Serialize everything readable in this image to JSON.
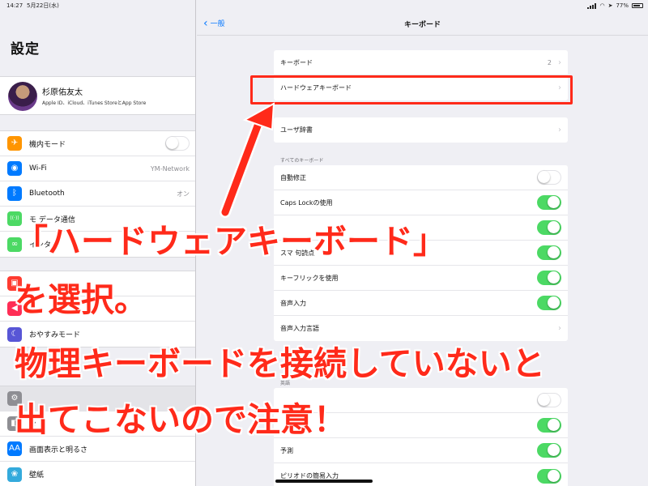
{
  "status_bar": {
    "time": "14:27",
    "date": "5月22日(水)",
    "battery": "77%"
  },
  "sidebar": {
    "title": "設定",
    "profile": {
      "name": "杉原佑友太",
      "subtitle": "Apple ID、iCloud、iTunes StoreとApp Store"
    },
    "group1": [
      {
        "label": "機内モード",
        "icon": "airplane-icon",
        "color": "#ff9500",
        "glyph": "✈",
        "toggle": "off"
      },
      {
        "label": "Wi-Fi",
        "icon": "wifi-icon",
        "color": "#007aff",
        "glyph": "◉",
        "value": "YM-Network"
      },
      {
        "label": "Bluetooth",
        "icon": "bluetooth-icon",
        "color": "#007aff",
        "glyph": "ᛒ",
        "value": "オン"
      },
      {
        "label": "モ  データ通信",
        "icon": "cellular-icon",
        "color": "#4cd964",
        "glyph": "((·))"
      },
      {
        "label": "インタ",
        "icon": "link-icon",
        "color": "#4cd964",
        "glyph": "∞"
      }
    ],
    "group2": [
      {
        "label": "",
        "icon": "notifications-icon",
        "color": "#ff3b30",
        "glyph": "▣"
      },
      {
        "label": "",
        "icon": "sounds-icon",
        "color": "#ff2d55",
        "glyph": "◀"
      },
      {
        "label": "おやすみモード",
        "icon": "moon-icon",
        "color": "#5856d6",
        "glyph": "☾"
      }
    ],
    "group3": [
      {
        "label": "",
        "icon": "gear-icon",
        "color": "#8e8e93",
        "glyph": "⚙",
        "selected": true
      },
      {
        "label": "タ",
        "icon": "control-center-icon",
        "color": "#8e8e93",
        "glyph": "◧"
      },
      {
        "label": "画面表示と明るさ",
        "icon": "display-icon",
        "color": "#007aff",
        "glyph": "AA"
      },
      {
        "label": "壁紙",
        "icon": "wallpaper-icon",
        "color": "#34aadc",
        "glyph": "❀"
      }
    ]
  },
  "main": {
    "back_label": "一般",
    "title": "キーボード",
    "group1": [
      {
        "label": "キーボード",
        "value": "2",
        "chevron": true
      },
      {
        "label": "ハードウェアキーボード",
        "chevron": true
      }
    ],
    "group2": [
      {
        "label": "ユーザ辞書",
        "chevron": true
      }
    ],
    "section_all_keyboards": "すべてのキーボード",
    "group3": [
      {
        "label": "自動修正",
        "toggle": "off"
      },
      {
        "label": "Caps Lockの使用",
        "toggle": "on"
      },
      {
        "label": "",
        "toggle": "on"
      },
      {
        "label": "スマ  句読点",
        "toggle": "on"
      },
      {
        "label": "キーフリックを使用",
        "toggle": "on"
      },
      {
        "label": "音声入力",
        "toggle": "on"
      },
      {
        "label": "音声入力言語",
        "chevron": true
      }
    ],
    "section_english": "英語",
    "group4": [
      {
        "label": "",
        "toggle": "off"
      },
      {
        "label": "",
        "toggle": "on"
      },
      {
        "label": "予測",
        "toggle": "on"
      },
      {
        "label": "ピリオドの簡易入力",
        "toggle": "on"
      }
    ]
  },
  "callout": {
    "line1": "「ハードウェアキーボード」",
    "line2": "を選択。",
    "line3": "物理キーボードを接続していないと",
    "line4": "出てこないので注意！"
  },
  "colors": {
    "annotation": "#ff2a1a",
    "toggle_on": "#4cd964",
    "link": "#0a7aff"
  }
}
